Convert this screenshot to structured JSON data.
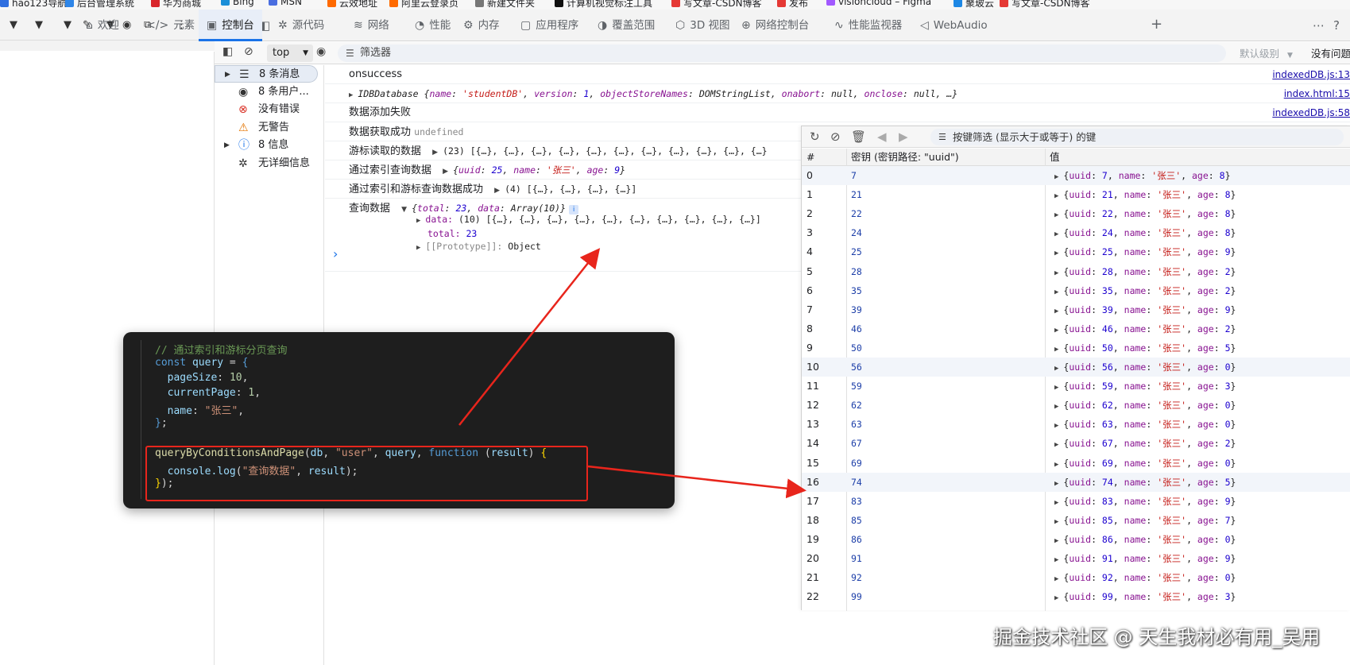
{
  "bookmarks": [
    {
      "label": "hao123导航",
      "color": "#2f6fe0"
    },
    {
      "label": "后台管理系统",
      "color": "#2f86e8"
    },
    {
      "label": "华为商城",
      "color": "#d9262c"
    },
    {
      "label": "Bing",
      "color": "#1b8fd8"
    },
    {
      "label": "MSN",
      "color": "#4a6ee0"
    },
    {
      "label": "云效地址",
      "color": "#ff6a00"
    },
    {
      "label": "阿里云登录页",
      "color": "#ff6a00"
    },
    {
      "label": "新建文件夹",
      "color": "#777777"
    },
    {
      "label": "计算机视觉标注工具",
      "color": "#111111"
    },
    {
      "label": "写文章-CSDN博客",
      "color": "#e53935"
    },
    {
      "label": "发布",
      "color": "#e53935"
    },
    {
      "label": "visioncloud – Figma",
      "color": "#a259ff"
    },
    {
      "label": "聚玻云",
      "color": "#1e88e5"
    },
    {
      "label": "写文章-CSDN博客",
      "color": "#e53935"
    }
  ],
  "tabs": [
    {
      "label": "欢迎",
      "icon": "home-icon",
      "glyph": "⌂"
    },
    {
      "label": "元素",
      "icon": "code-icon",
      "glyph": "</>"
    },
    {
      "label": "控制台",
      "icon": "console-icon",
      "glyph": "▣",
      "active": true
    },
    {
      "label": "源代码",
      "icon": "bug-icon",
      "glyph": "✲"
    },
    {
      "label": "网络",
      "icon": "wifi-icon",
      "glyph": "≋"
    },
    {
      "label": "性能",
      "icon": "gauge-icon",
      "glyph": "◔"
    },
    {
      "label": "内存",
      "icon": "chip-icon",
      "glyph": "⚙"
    },
    {
      "label": "应用程序",
      "icon": "app-icon",
      "glyph": "▢"
    },
    {
      "label": "覆盖范围",
      "icon": "coverage-icon",
      "glyph": "◑"
    },
    {
      "label": "3D 视图",
      "icon": "cube-icon",
      "glyph": "⬡"
    },
    {
      "label": "网络控制台",
      "icon": "globe-icon",
      "glyph": "⊕"
    },
    {
      "label": "性能监视器",
      "icon": "pulse-icon",
      "glyph": "∿"
    },
    {
      "label": "WebAudio",
      "icon": "speaker-icon",
      "glyph": "◁"
    }
  ],
  "console_toolbar": {
    "context": "top",
    "filter_placeholder": "筛选器",
    "level": "默认级别",
    "issues": "没有问题"
  },
  "sidebar": [
    {
      "label": "8 条消息",
      "icon": "list-icon",
      "glyph": "☰",
      "caret": true,
      "color": "#333333"
    },
    {
      "label": "8 条用户...",
      "icon": "user-icon",
      "glyph": "◉",
      "caret": false,
      "color": "#333333"
    },
    {
      "label": "没有错误",
      "icon": "error-icon",
      "glyph": "⊗",
      "caret": false,
      "color": "#d93025"
    },
    {
      "label": "无警告",
      "icon": "warning-icon",
      "glyph": "⚠",
      "caret": false,
      "color": "#e37400"
    },
    {
      "label": "8 信息",
      "icon": "info-icon",
      "glyph": "ⓘ",
      "caret": true,
      "color": "#1a73e8"
    },
    {
      "label": "无详细信息",
      "icon": "bug-icon",
      "glyph": "✲",
      "caret": false,
      "color": "#333333"
    }
  ],
  "console": {
    "m1_text": "onsuccess",
    "m1_src": "indexedDB.js:13",
    "m2_label": "IDBDatabase",
    "m2_src": "index.html:15",
    "m3_text": "数据添加失败",
    "m3_src": "indexedDB.js:58",
    "m4_text": "数据获取成功",
    "m4_value": "undefined",
    "m5_text": "游标读取的数据",
    "m5_value": "(23) [{…}, {…}, {…}, {…}, {…}, {…}, {…}, {…}, {…}, {…}, {…}",
    "m6_text": "通过索引查询数据",
    "m7_text": "通过索引和游标查询数据成功",
    "m7_value": "(4) [{…}, {…}, {…}, {…}]",
    "m8_text": "查询数据",
    "m8_data_key": "data:",
    "m8_data_value": "(10) [{…}, {…}, {…}, {…}, {…}, {…}, {…}, {…}, {…}, {…}]",
    "m8_total_key": "total:",
    "m8_total_value": "23",
    "m8_proto_key": "[[Prototype]]:",
    "m8_proto_value": "Object",
    "prompt": "›"
  },
  "app_panel": {
    "filter_placeholder": "按键筛选 (显示大于或等于) 的键",
    "col_index": "#",
    "col_key": "密钥 (密钥路径: \"uuid\")",
    "col_value": "值",
    "rows": [
      {
        "i": "0",
        "key": "7",
        "age": "8"
      },
      {
        "i": "1",
        "key": "21",
        "age": "8"
      },
      {
        "i": "2",
        "key": "22",
        "age": "8"
      },
      {
        "i": "3",
        "key": "24",
        "age": "8"
      },
      {
        "i": "4",
        "key": "25",
        "age": "9"
      },
      {
        "i": "5",
        "key": "28",
        "age": "2"
      },
      {
        "i": "6",
        "key": "35",
        "age": "2"
      },
      {
        "i": "7",
        "key": "39",
        "age": "9"
      },
      {
        "i": "8",
        "key": "46",
        "age": "2"
      },
      {
        "i": "9",
        "key": "50",
        "age": "5"
      },
      {
        "i": "10",
        "key": "56",
        "age": "0"
      },
      {
        "i": "11",
        "key": "59",
        "age": "3"
      },
      {
        "i": "12",
        "key": "62",
        "age": "0"
      },
      {
        "i": "13",
        "key": "63",
        "age": "0"
      },
      {
        "i": "14",
        "key": "67",
        "age": "2"
      },
      {
        "i": "15",
        "key": "69",
        "age": "0"
      },
      {
        "i": "16",
        "key": "74",
        "age": "5"
      },
      {
        "i": "17",
        "key": "83",
        "age": "9"
      },
      {
        "i": "18",
        "key": "85",
        "age": "7"
      },
      {
        "i": "19",
        "key": "86",
        "age": "0"
      },
      {
        "i": "20",
        "key": "91",
        "age": "9"
      },
      {
        "i": "21",
        "key": "92",
        "age": "0"
      },
      {
        "i": "22",
        "key": "99",
        "age": "3"
      }
    ],
    "name_value": "张三"
  },
  "code": {
    "comment": "// 通过索引和游标分页查询",
    "kw_const": "const",
    "var_query": "query",
    "page_size_key": "pageSize",
    "page_size_val": "10",
    "current_page_key": "currentPage",
    "current_page_val": "1",
    "name_key": "name",
    "name_val": "\"张三\"",
    "fn_name": "queryByConditionsAndPage",
    "arg_db": "db",
    "arg_user": "\"user\"",
    "kw_function": "function",
    "arg_result": "result",
    "console_log": "console.log",
    "log_str": "\"查询数据\""
  },
  "watermark": "掘金技术社区 @ 天生我材必有用_吴用"
}
